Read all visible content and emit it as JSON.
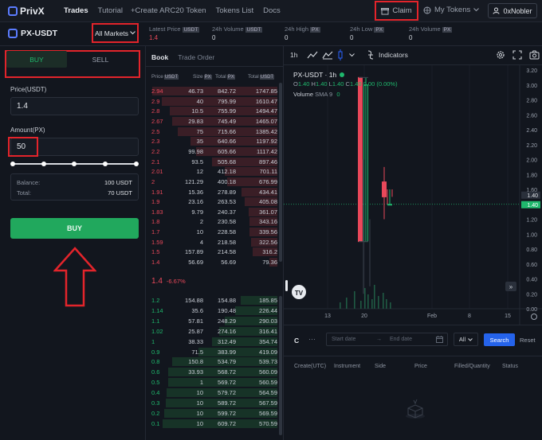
{
  "nav": {
    "brand": "PrivX",
    "links": [
      "Trades",
      "Tutorial",
      "+Create ARC20 Token",
      "Tokens List",
      "Docs"
    ],
    "claim": "Claim",
    "my_tokens": "My Tokens",
    "user": "0xNobler"
  },
  "market": {
    "pair": "PX-USDT",
    "all_markets": "All Markets",
    "stats": [
      {
        "label": "Latest Price",
        "unit": "USDT",
        "value": "1.4",
        "color": "#e9485a"
      },
      {
        "label": "24h Volume",
        "unit": "USDT",
        "value": "0"
      },
      {
        "label": "24h High",
        "unit": "PX",
        "value": "0"
      },
      {
        "label": "24h Low",
        "unit": "PX",
        "value": "0"
      },
      {
        "label": "24h Volume",
        "unit": "PX",
        "value": "0"
      }
    ]
  },
  "form": {
    "buy_tab": "BUY",
    "sell_tab": "SELL",
    "price_label": "Price(USDT)",
    "price_value": "1.4",
    "amount_label": "Amount(PX)",
    "amount_value": "50",
    "balance_label": "Balance:",
    "balance_value": "100 USDT",
    "total_label": "Total:",
    "total_value": "70 USDT",
    "submit": "BUY"
  },
  "book": {
    "tabs": [
      "Book",
      "Trade Order"
    ],
    "headers": [
      {
        "label": "Price",
        "unit": "USDT"
      },
      {
        "label": "Size",
        "unit": "PX"
      },
      {
        "label": "Total",
        "unit": "PX"
      },
      {
        "label": "Total",
        "unit": "USDT"
      }
    ],
    "asks": [
      {
        "p": "2.94",
        "s": "46.73",
        "t": "842.72",
        "tt": "1747.85",
        "depth": 0.95
      },
      {
        "p": "2.9",
        "s": "40",
        "t": "795.99",
        "tt": "1610.47",
        "depth": 0.88
      },
      {
        "p": "2.8",
        "s": "10.5",
        "t": "755.99",
        "tt": "1494.47",
        "depth": 0.82
      },
      {
        "p": "2.67",
        "s": "29.83",
        "t": "745.49",
        "tt": "1465.07",
        "depth": 0.8
      },
      {
        "p": "2.5",
        "s": "75",
        "t": "715.66",
        "tt": "1385.42",
        "depth": 0.76
      },
      {
        "p": "2.3",
        "s": "35",
        "t": "640.66",
        "tt": "1197.92",
        "depth": 0.66
      },
      {
        "p": "2.2",
        "s": "99.98",
        "t": "605.66",
        "tt": "1117.42",
        "depth": 0.62
      },
      {
        "p": "2.1",
        "s": "93.5",
        "t": "505.68",
        "tt": "897.46",
        "depth": 0.5
      },
      {
        "p": "2.01",
        "s": "12",
        "t": "412.18",
        "tt": "701.11",
        "depth": 0.4
      },
      {
        "p": "2",
        "s": "121.29",
        "t": "400.18",
        "tt": "676.99",
        "depth": 0.38
      },
      {
        "p": "1.91",
        "s": "15.36",
        "t": "278.89",
        "tt": "434.41",
        "depth": 0.27
      },
      {
        "p": "1.9",
        "s": "23.16",
        "t": "263.53",
        "tt": "405.08",
        "depth": 0.25
      },
      {
        "p": "1.83",
        "s": "9.79",
        "t": "240.37",
        "tt": "361.07",
        "depth": 0.22
      },
      {
        "p": "1.8",
        "s": "2",
        "t": "230.58",
        "tt": "343.16",
        "depth": 0.21
      },
      {
        "p": "1.7",
        "s": "10",
        "t": "228.58",
        "tt": "339.56",
        "depth": 0.21
      },
      {
        "p": "1.59",
        "s": "4",
        "t": "218.58",
        "tt": "322.56",
        "depth": 0.2
      },
      {
        "p": "1.5",
        "s": "157.89",
        "t": "214.58",
        "tt": "316.2",
        "depth": 0.19
      },
      {
        "p": "1.4",
        "s": "56.69",
        "t": "56.69",
        "tt": "79.36",
        "depth": 0.06
      }
    ],
    "mid_price": "1.4",
    "mid_change": "-6.67%",
    "bids": [
      {
        "p": "1.2",
        "s": "154.88",
        "t": "154.88",
        "tt": "185.85",
        "depth": 0.28
      },
      {
        "p": "1.14",
        "s": "35.6",
        "t": "190.48",
        "tt": "226.44",
        "depth": 0.32
      },
      {
        "p": "1.1",
        "s": "57.81",
        "t": "248.29",
        "tt": "290.03",
        "depth": 0.4
      },
      {
        "p": "1.02",
        "s": "25.87",
        "t": "274.16",
        "tt": "316.41",
        "depth": 0.44
      },
      {
        "p": "1",
        "s": "38.33",
        "t": "312.49",
        "tt": "354.74",
        "depth": 0.5
      },
      {
        "p": "0.9",
        "s": "71.5",
        "t": "383.99",
        "tt": "419.09",
        "depth": 0.6
      },
      {
        "p": "0.8",
        "s": "150.8",
        "t": "534.79",
        "tt": "539.73",
        "depth": 0.8
      },
      {
        "p": "0.6",
        "s": "33.93",
        "t": "568.72",
        "tt": "560.09",
        "depth": 0.83
      },
      {
        "p": "0.5",
        "s": "1",
        "t": "569.72",
        "tt": "560.59",
        "depth": 0.83
      },
      {
        "p": "0.4",
        "s": "10",
        "t": "579.72",
        "tt": "564.59",
        "depth": 0.84
      },
      {
        "p": "0.3",
        "s": "10",
        "t": "589.72",
        "tt": "567.59",
        "depth": 0.85
      },
      {
        "p": "0.2",
        "s": "10",
        "t": "599.72",
        "tt": "569.59",
        "depth": 0.86
      },
      {
        "p": "0.1",
        "s": "10",
        "t": "609.72",
        "tt": "570.59",
        "depth": 0.87
      }
    ]
  },
  "chart": {
    "interval": "1h",
    "indicators": "Indicators",
    "title": "PX-USDT · 1h",
    "ohlc": {
      "o": "1.40",
      "h": "1.40",
      "l": "1.40",
      "c": "1.40",
      "chg": "0.00 (0.00%)"
    },
    "volume_legend": "Volume",
    "volume_sma": "SMA 9",
    "volume_value": "0",
    "price_labels": [
      "1.40",
      "1.40"
    ]
  },
  "chart_data": {
    "type": "candlestick",
    "title": "PX-USDT · 1h",
    "y_ticks": [
      3.2,
      3.0,
      2.8,
      2.6,
      2.4,
      2.2,
      2.0,
      1.8,
      1.6,
      1.4,
      1.2,
      1.0,
      0.8,
      0.6,
      0.4,
      0.2,
      0.0
    ],
    "x_ticks": [
      "13",
      "20",
      "Feb",
      "8",
      "15"
    ],
    "last_price": 1.4,
    "ylim": [
      0,
      3.2
    ],
    "notable_candles": [
      {
        "x": "~18",
        "open": 3.1,
        "close": 0.9,
        "high": 3.1,
        "low": 0.9
      },
      {
        "x": "~19",
        "open": 0.9,
        "close": 3.0,
        "high": 3.1,
        "low": 0.9
      },
      {
        "x": "~20",
        "open": 1.7,
        "close": 1.5,
        "high": 1.9,
        "low": 1.2
      },
      {
        "x": "~21",
        "open": 1.4,
        "close": 1.4,
        "high": 1.6,
        "low": 1.4
      }
    ]
  },
  "orders": {
    "tab": "C",
    "start_placeholder": "Start date",
    "end_placeholder": "End date",
    "filter": "All",
    "search": "Search",
    "reset": "Reset",
    "columns": [
      "Create(UTC)",
      "Instrument",
      "Side",
      "Price",
      "Filled/Quantity",
      "Status"
    ]
  }
}
